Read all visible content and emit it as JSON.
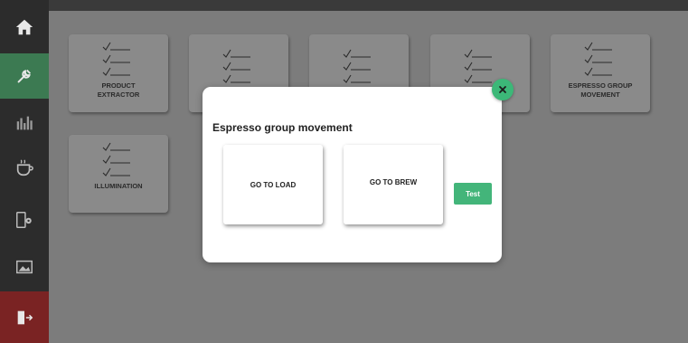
{
  "sidebar": {
    "items": [
      {
        "icon": "home-icon"
      },
      {
        "icon": "wrench-icon"
      },
      {
        "icon": "stats-icon"
      },
      {
        "icon": "coffee-cup-icon"
      },
      {
        "icon": "device-settings-icon"
      },
      {
        "icon": "image-icon"
      },
      {
        "icon": "exit-icon"
      }
    ],
    "active_color": "#3c7a52",
    "exit_color": "#7a2323"
  },
  "tiles": [
    {
      "label_line1": "PRODUCT",
      "label_line2": "EXTRACTOR"
    },
    {
      "label_line1": "",
      "label_line2": ""
    },
    {
      "label_line1": "",
      "label_line2": ""
    },
    {
      "label_line1": "",
      "label_line2": ""
    },
    {
      "label_line1": "ESPRESSO GROUP",
      "label_line2": "MOVEMENT"
    },
    {
      "label_line1": "ILLUMINATION",
      "label_line2": ""
    }
  ],
  "modal": {
    "title": "Espresso group movement",
    "go_to_load_label": "GO TO LOAD",
    "go_to_brew_label": "GO TO BREW",
    "test_label": "Test",
    "accent_color": "#43b57a"
  }
}
